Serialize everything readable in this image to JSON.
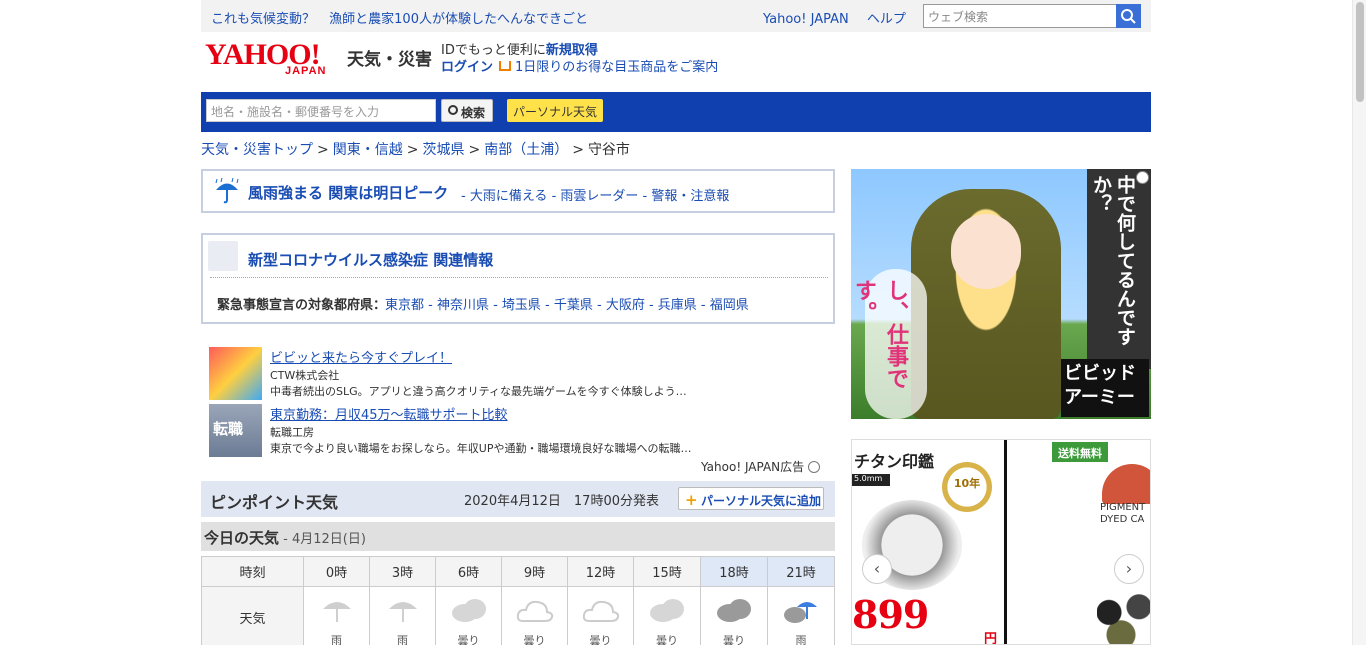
{
  "topbar": {
    "promo_1": "これも気候変動？",
    "promo_2": "漁師と農家100人が体験したへんなできごと",
    "link_yahoo": "Yahoo! JAPAN",
    "link_help": "ヘルプ",
    "search_placeholder": "ウェブ検索"
  },
  "header": {
    "logo_text": "YAHOO!",
    "logo_sub": "JAPAN",
    "service_name": "天気・災害",
    "id_prompt": "IDでもっと便利に",
    "register": "新規取得",
    "login": "ログイン",
    "deal": "1日限りのお得な目玉商品をご案内"
  },
  "searchbar": {
    "placeholder": "地名・施設名・郵便番号を入力",
    "search_label": "検索",
    "personal_label": "パーソナル天気"
  },
  "breadcrumb": {
    "items": [
      "天気・災害トップ",
      "関東・信越",
      "茨城県",
      "南部（土浦）"
    ],
    "current": "守谷市",
    "sep": ">"
  },
  "alert1": {
    "title": "風雨強まる 関東は明日ピーク",
    "links": "- 大雨に備える - 雨雲レーダー - 警報・注意報"
  },
  "alert2": {
    "title": "新型コロナウイルス感染症 関連情報",
    "label": "緊急事態宣言の対象都府県",
    "colon": "：",
    "prefectures": "東京都 - 神奈川県 - 埼玉県 - 千葉県 - 大阪府 - 兵庫県 - 福岡県"
  },
  "ads": [
    {
      "title": "ビビッと来たら今すぐプレイ！",
      "company": "CTW株式会社",
      "desc": "中毒者続出のSLG。アプリと違う高クオリティな最先端ゲームを今すぐ体験しよう…"
    },
    {
      "title": "東京勤務：月収45万〜転職サポート比較",
      "company": "転職工房",
      "desc": "東京で今より良い職場をお探しなら。年収UPや通勤・職場環境良好な職場への転職…"
    }
  ],
  "ad_thumb_2": "転職",
  "ad_label": "Yahoo! JAPAN広告",
  "pinpoint": {
    "title": "ピンポイント天気",
    "issued": "2020年4月12日　17時00分発表",
    "add_label": "パーソナル天気に追加"
  },
  "today": {
    "title": "今日の天気",
    "date": " - 4月12日(日)"
  },
  "forecast": {
    "time_label": "時刻",
    "weather_label": "天気",
    "hours": [
      "0時",
      "3時",
      "6時",
      "9時",
      "12時",
      "15時",
      "18時",
      "21時"
    ],
    "conditions": [
      "雨",
      "雨",
      "曇り",
      "曇り",
      "曇り",
      "曇り",
      "曇り",
      "雨"
    ]
  },
  "banner1": {
    "vertical": "中で何してるんですか？",
    "pink": "し、仕事です。",
    "logo": "ビビッドアーミー"
  },
  "banner2": {
    "title": "チタン印鑑",
    "size": "5.0mm",
    "badge": "10年",
    "price": "899",
    "yen": "円",
    "ship": "送料無料",
    "product": "PIGMENT\nDYED CA"
  },
  "colors": {
    "brand_red": "#e60012",
    "link_blue": "#1a4db3",
    "bar_blue": "#1040b0",
    "personal_yellow": "#ffe24a"
  }
}
